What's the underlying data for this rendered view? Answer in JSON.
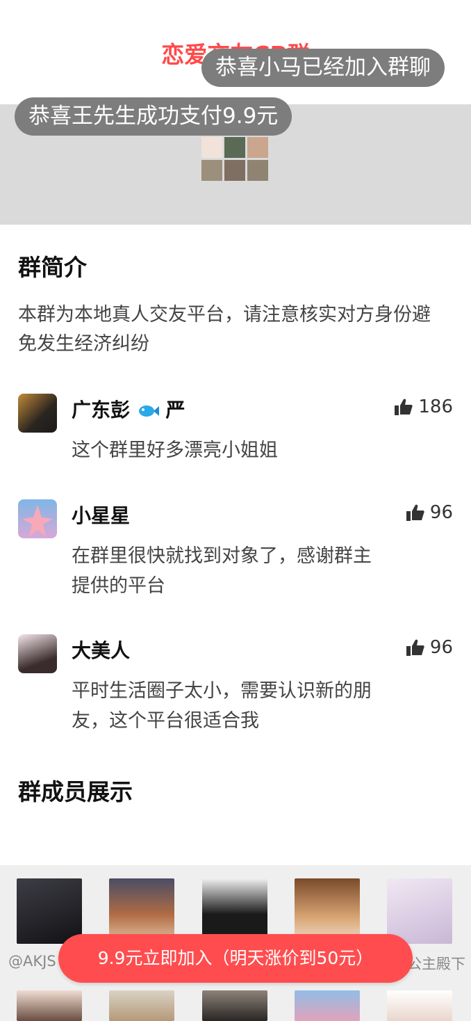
{
  "header": {
    "title": "恋爱交友CP群",
    "title_color": "#ff4a4a",
    "toasts": [
      "恭喜小马已经加入群聊",
      "恭喜王先生成功支付9.9元"
    ]
  },
  "intro": {
    "title": "群简介",
    "text": "本群为本地真人交友平台，请注意核实对方身份避免发生经济纠纷"
  },
  "reviews": [
    {
      "name": "广东彭",
      "name_suffix": "严",
      "emoji": "fish-emoji",
      "likes": "186",
      "text": "这个群里好多漂亮小姐姐"
    },
    {
      "name": "小星星",
      "likes": "96",
      "text": "在群里很快就找到对象了，感谢群主提供的平台"
    },
    {
      "name": "大美人",
      "likes": "96",
      "text": "平时生活圈子太小，需要认识新的朋友，这个平台很适合我"
    }
  ],
  "members": {
    "title": "群成员展示",
    "caption_left": "@AKJS",
    "caption_right": "公主殿下"
  },
  "cta": {
    "label": "9.9元立即加入（明天涨价到50元）",
    "color": "#ff4d4f"
  }
}
